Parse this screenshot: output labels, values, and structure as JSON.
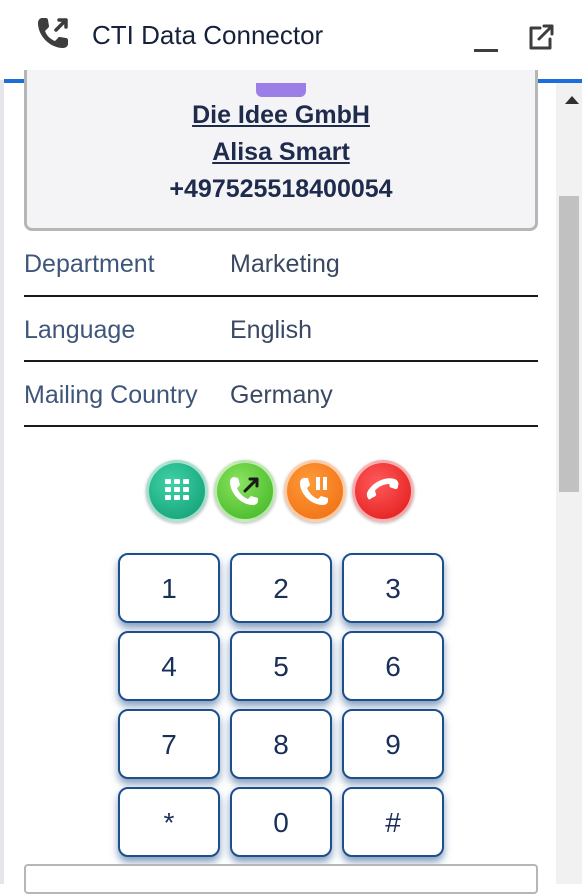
{
  "header": {
    "title": "CTI Data Connector",
    "icons": [
      "phone-transfer-icon",
      "minimize-icon",
      "popout-icon"
    ]
  },
  "contact": {
    "company": "Die Idee GmbH",
    "name": "Alisa Smart",
    "phone": "+497525518400054"
  },
  "fields": [
    {
      "label": "Department",
      "value": "Marketing"
    },
    {
      "label": "Language",
      "value": "English"
    },
    {
      "label": "Mailing Country",
      "value": "Germany"
    }
  ],
  "call_actions": [
    {
      "name": "dialpad",
      "icon": "dialpad-icon",
      "color": "#16a97d"
    },
    {
      "name": "transfer",
      "icon": "call-transfer-icon",
      "color": "#4ec12b"
    },
    {
      "name": "hold",
      "icon": "hold-icon",
      "color": "#f47a16"
    },
    {
      "name": "hangup",
      "icon": "hangup-icon",
      "color": "#ec2424"
    }
  ],
  "keypad": {
    "keys": [
      "1",
      "2",
      "3",
      "4",
      "5",
      "6",
      "7",
      "8",
      "9",
      "*",
      "0",
      "#"
    ]
  },
  "colors": {
    "accent": "#1b6fd8",
    "key_border": "#1d4f8a"
  }
}
